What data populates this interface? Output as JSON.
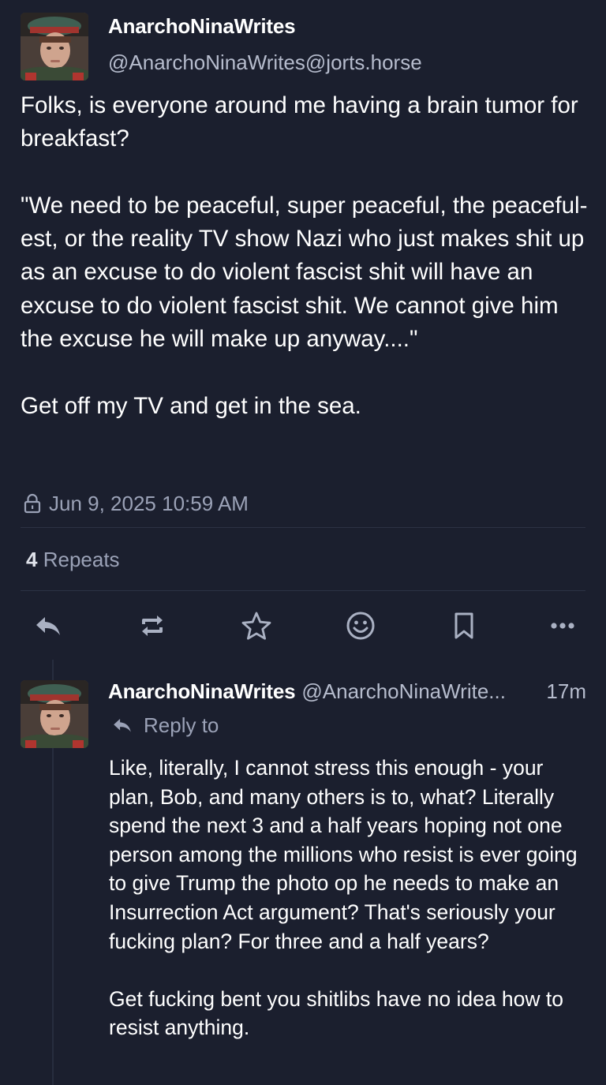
{
  "main_post": {
    "display_name": "AnarchoNinaWrites",
    "handle": "@AnarchoNinaWrites@jorts.horse",
    "text": "Folks, is everyone around me having a brain tumor for breakfast?\n\n\"We need to be peaceful, super peaceful, the peaceful-est, or the reality TV show Nazi who just makes shit up as an excuse to do violent fascist shit will have an excuse to do violent fascist shit. We cannot give him the excuse he will make up anyway....\"\n\nGet off my TV and get in the sea.",
    "timestamp": "Jun 9, 2025 10:59 AM",
    "visibility_icon": "lock-icon",
    "repeats_count": "4",
    "repeats_label": "Repeats",
    "actions": [
      "reply-icon",
      "boost-icon",
      "star-icon",
      "emoji-icon",
      "bookmark-icon",
      "more-icon"
    ]
  },
  "reply_post": {
    "display_name": "AnarchoNinaWrites",
    "handle": "@AnarchoNinaWrite...",
    "time_ago": "17m",
    "reply_to_label": "Reply to",
    "text": "Like, literally, I cannot stress this enough - your plan, Bob, and many others is to, what? Literally spend the next 3 and a half years hoping not one person among the millions who resist is ever going to give Trump the photo op he needs to make an Insurrection Act argument? That's seriously your fucking plan? For three and a half years?\n\nGet fucking bent you shitlibs have no idea how to resist anything."
  },
  "colors": {
    "background": "#1b1f2e",
    "text_primary": "#ffffff",
    "text_secondary": "#b6bccd",
    "icon": "#aab1c3",
    "divider": "#2c3244"
  }
}
